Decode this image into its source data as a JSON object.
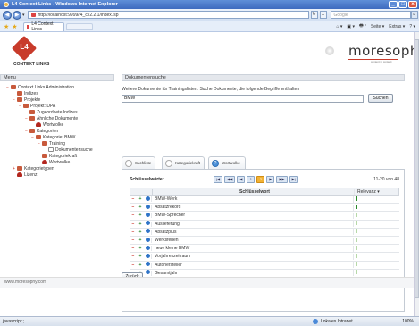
{
  "window": {
    "title": "L4 Context Links - Windows Internet Explorer",
    "close_glyph": "x",
    "min_glyph": "_",
    "max_glyph": "□"
  },
  "nav": {
    "back_glyph": "◀",
    "forward_glyph": "▶",
    "drop_glyph": "▾",
    "address": "http://localhost:9999/l4_cl/2.2.1/index.jsp",
    "refresh_glyph": "↻",
    "stop_glyph": "x",
    "search_placeholder": "Google",
    "search_glyph": "⌕"
  },
  "favbar": {
    "star_glyph": "★",
    "add_glyph": "★",
    "tab_label": "L4 Context Links",
    "tools": [
      "⌂ ▾",
      "▣ ▾",
      "🖶 ▾",
      "Seite ▾",
      "Extras ▾",
      "? ▾"
    ]
  },
  "header": {
    "logo_num": "L4",
    "logo_text": "CONTEXT LINKS",
    "brand": "moresophy",
    "brand_tag": "content in context"
  },
  "sidebar": {
    "title": "Menu",
    "items": [
      {
        "label": "Context Links Administration",
        "indent": 1,
        "icon": "folder",
        "exp": "−"
      },
      {
        "label": "Indizes",
        "indent": 2,
        "icon": "folder",
        "exp": ""
      },
      {
        "label": "Projekte",
        "indent": 2,
        "icon": "folder",
        "exp": "−"
      },
      {
        "label": "Projekt: DPA",
        "indent": 3,
        "icon": "folder",
        "exp": "−"
      },
      {
        "label": "Zugeordnete Indizes",
        "indent": 4,
        "icon": "folder",
        "exp": ""
      },
      {
        "label": "Ähnliche Dokumente",
        "indent": 4,
        "icon": "folder",
        "exp": "−"
      },
      {
        "label": "Wortwolke",
        "indent": 5,
        "icon": "sign",
        "exp": ""
      },
      {
        "label": "Kategorien",
        "indent": 4,
        "icon": "folder",
        "exp": "−"
      },
      {
        "label": "Kategorie: BMW",
        "indent": 5,
        "icon": "folder",
        "exp": "−"
      },
      {
        "label": "Training",
        "indent": 6,
        "icon": "folder",
        "exp": "−"
      },
      {
        "label": "Dokumentensuche",
        "indent": 7,
        "icon": "doc",
        "exp": ""
      },
      {
        "label": "Kategoriekraft",
        "indent": 6,
        "icon": "folder",
        "exp": ""
      },
      {
        "label": "Wortwolke",
        "indent": 6,
        "icon": "sign",
        "exp": ""
      },
      {
        "label": "Kategorietypen",
        "indent": 2,
        "icon": "folder",
        "exp": "+"
      },
      {
        "label": "Lizenz",
        "indent": 2,
        "icon": "sign",
        "exp": ""
      }
    ]
  },
  "main": {
    "title": "Dokumentensuche",
    "intro": "Weitere Dokumente für Trainingslisten: Suche Dokumente, die folgende Begriffe enthalten",
    "query": "BMW",
    "search_label": "Suchen",
    "tabs": [
      {
        "label": "Suchliste",
        "glyph": ""
      },
      {
        "label": "Kategoriekraft",
        "glyph": ""
      },
      {
        "label": "Wortwolke",
        "glyph": "?"
      }
    ],
    "panel_title": "Schlüsselwörter",
    "pager": [
      "|◀",
      "◀◀",
      "◀",
      "1",
      "2",
      "▶",
      "▶▶",
      "▶|"
    ],
    "count": "11-20 von 48",
    "col_keyword": "Schlüsselwort",
    "col_relevance": "Relevanz ▾",
    "minus_glyph": "−",
    "plus_glyph": "+",
    "rows": [
      "BMW-Werk",
      "Absatzrekord",
      "BMW-Sprecher",
      "Auslieferung",
      "Absatzplus",
      "Werksferien",
      "neue kleine BMW",
      "Vorjahreszeitraum",
      "Autohersteller",
      "Gesamtjahr"
    ],
    "relevance": [
      0.9,
      0.9,
      0.4,
      0.4,
      0.4,
      0.4,
      0.4,
      0.4,
      0.4,
      0.4
    ],
    "back_label": "Zurück"
  },
  "footer": {
    "text": "www.moresophy.com"
  },
  "status": {
    "left": "javascript:;",
    "zone": "Lokales Intranet",
    "zoom": "100%"
  }
}
